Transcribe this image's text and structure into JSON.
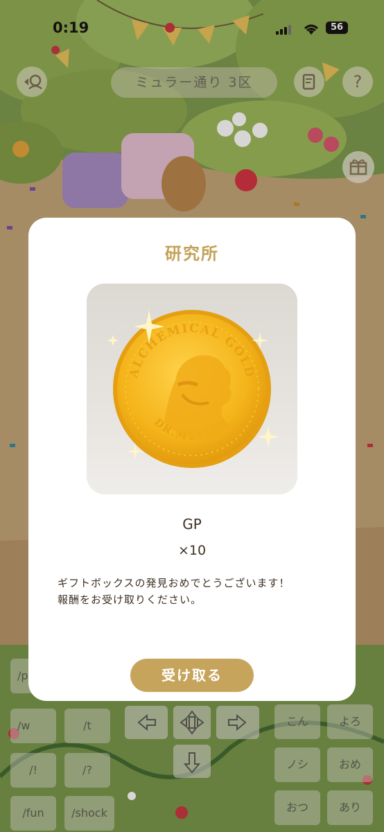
{
  "status_bar": {
    "time": "0:19",
    "battery": "56"
  },
  "top_bar": {
    "area_name": "ミュラー通り 3区",
    "help_label": "?"
  },
  "chat_keys": [
    "/p",
    "/w",
    "/t",
    "/!",
    "/?",
    "/fun",
    "/shock"
  ],
  "emote_keys": [
    "こん",
    "よろ",
    "ノシ",
    "おめ",
    "おつ",
    "あり"
  ],
  "modal": {
    "title": "研究所",
    "item_name": "GP",
    "item_quantity": "×10",
    "coin_text_top": "ALCHEMICAL GOLD",
    "coin_text_bottom": "DR.MULLER",
    "message_line1": "ギフトボックスの発見おめでとうございます！",
    "message_line2": "報酬をお受け取りください。",
    "accept_button": "受け取る"
  },
  "colors": {
    "accent": "#c7a45c",
    "title": "#c3a157",
    "text": "#3e3022"
  },
  "icons": [
    "back-icon",
    "pet-icon",
    "memo-icon",
    "help-icon",
    "gift-box-icon",
    "arrow-left-icon",
    "arrow-right-icon",
    "arrow-down-icon",
    "move-icon"
  ]
}
